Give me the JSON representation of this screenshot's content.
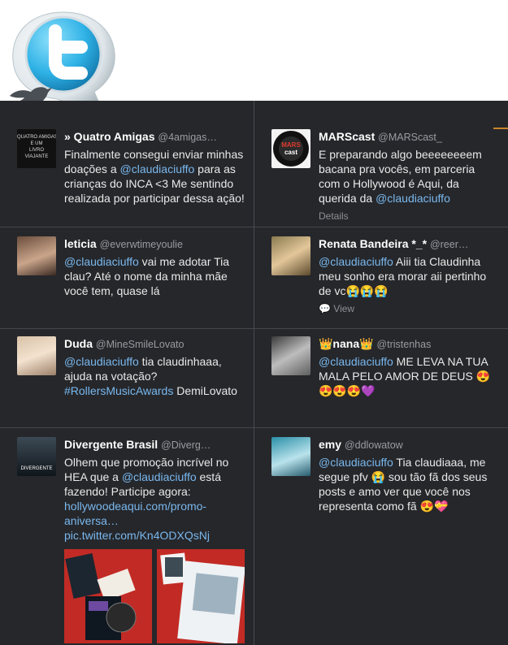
{
  "colors": {
    "panel": "#26272b",
    "link": "#79b8ee",
    "accent": "#c9852b"
  },
  "logo_icon": "twitter-bird-speech-bubble-icon",
  "tweets": [
    {
      "name": "» Quatro Amigas",
      "handle": "@4amigas…",
      "t1": "Finalmente consegui enviar minhas doações a ",
      "m1": "@claudiaciuffo",
      "t2": " para as crianças do INCA <3 Me sentindo realizada por participar dessa ação!",
      "avatar_text": "QUATRO AMIGAS\nE UM\nLIVRO\nVIAJANTE"
    },
    {
      "name": "MARScast",
      "handle": "@MARScast_",
      "t1": "E preparando algo beeeeeeeem bacana pra vocês, em parceria com o Hollywood é Aqui, da querida da ",
      "m1": "@claudiaciuffo",
      "meta": "Details",
      "avatar_text": "MARS\ncast"
    },
    {
      "name": "leticia",
      "handle": "@everwtimeyoulie",
      "m1": "@claudiaciuffo",
      "t2": " vai me adotar Tia clau? Até o nome da minha mãe você tem, quase lá"
    },
    {
      "name": "Renata Bandeira *_*",
      "handle": "@reer…",
      "m1": "@claudiaciuffo",
      "t2": " Aiii tia Claudinha meu sonho era morar aii pertinho de vc😭😭😭",
      "meta": "View"
    },
    {
      "name": "Duda",
      "handle": "@MineSmileLovato",
      "m1": "@claudiaciuffo",
      "t2": " tia claudinhaaa, ajuda na votação? ",
      "m2": "#RollersMusicAwards",
      "t3": " DemiLovato"
    },
    {
      "name": "👑nana👑",
      "handle": "@tristenhas",
      "m1": "@claudiaciuffo",
      "t2": " ME LEVA NA TUA MALA PELO AMOR DE DEUS 😍😍😍😍💜"
    },
    {
      "name": "Divergente Brasil",
      "handle": "@Diverg…",
      "t1": "Olhem que promoção incrível no HEA que a ",
      "m1": "@claudiaciuffo",
      "t2": " está fazendo! Participe agora: ",
      "m2": "hollywoodeaqui.com/promo-aniversa…",
      "t3": " ",
      "m3": "pic.twitter.com/Kn4ODXQsNj",
      "avatar_text": "DIVERGENTE"
    },
    {
      "name": "emy",
      "handle": "@ddlowatow",
      "m1": "@claudiaciuffo",
      "t2": " Tia claudiaaa, me segue pfv 😭 sou tão fã dos seus posts e amo ver que você nos representa como fã 😍💝"
    }
  ]
}
